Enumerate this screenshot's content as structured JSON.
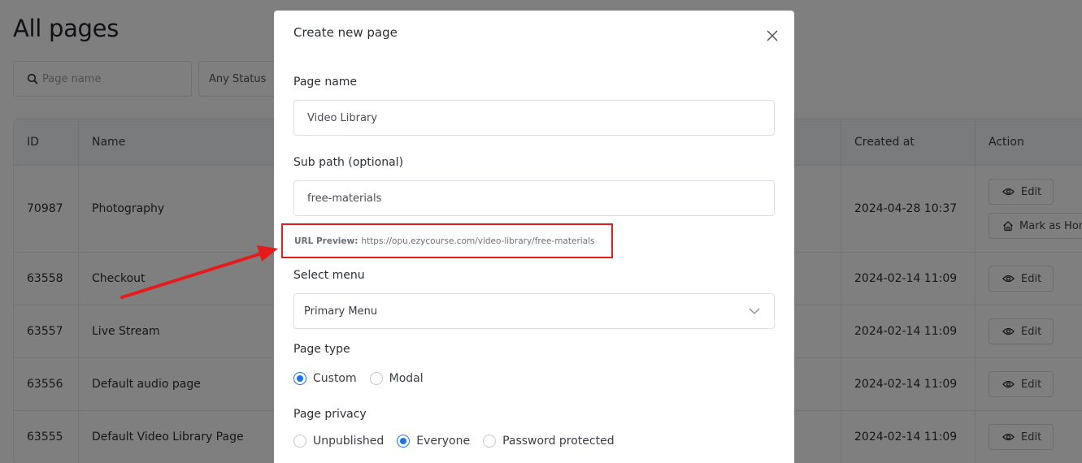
{
  "background": {
    "title": "All pages",
    "search_placeholder": "Page name",
    "status_filter": "Any Status",
    "columns": {
      "id": "ID",
      "name": "Name",
      "created": "Created at",
      "action": "Action"
    },
    "rows": [
      {
        "id": "70987",
        "name": "Photography",
        "created": "2024-04-28 10:37",
        "has_home": true
      },
      {
        "id": "63558",
        "name": "Checkout",
        "created": "2024-02-14 11:09",
        "has_home": false
      },
      {
        "id": "63557",
        "name": "Live Stream",
        "created": "2024-02-14 11:09",
        "has_home": false
      },
      {
        "id": "63556",
        "name": "Default audio page",
        "created": "2024-02-14 11:09",
        "has_home": false
      },
      {
        "id": "63555",
        "name": "Default Video Library Page",
        "created": "2024-02-14 11:09",
        "has_home": false
      }
    ],
    "edit_label": "Edit",
    "home_label": "Mark as Home"
  },
  "modal": {
    "title": "Create new page",
    "page_name_label": "Page name",
    "page_name_value": "Video Library",
    "sub_path_label": "Sub path (optional)",
    "sub_path_value": "free-materials",
    "url_preview_label": "URL Preview:",
    "url_preview_value": "https://opu.ezycourse.com/video-library/free-materials",
    "select_menu_label": "Select menu",
    "select_menu_value": "Primary Menu",
    "page_type_label": "Page type",
    "page_type_options": [
      "Custom",
      "Modal"
    ],
    "page_type_selected": "Custom",
    "page_privacy_label": "Page privacy",
    "page_privacy_options": [
      "Unpublished",
      "Everyone",
      "Password protected"
    ],
    "page_privacy_selected": "Everyone"
  },
  "colors": {
    "accent": "#1a73e8",
    "highlight": "#e61c1c",
    "overlay": "rgba(0,0,0,0.5)"
  }
}
